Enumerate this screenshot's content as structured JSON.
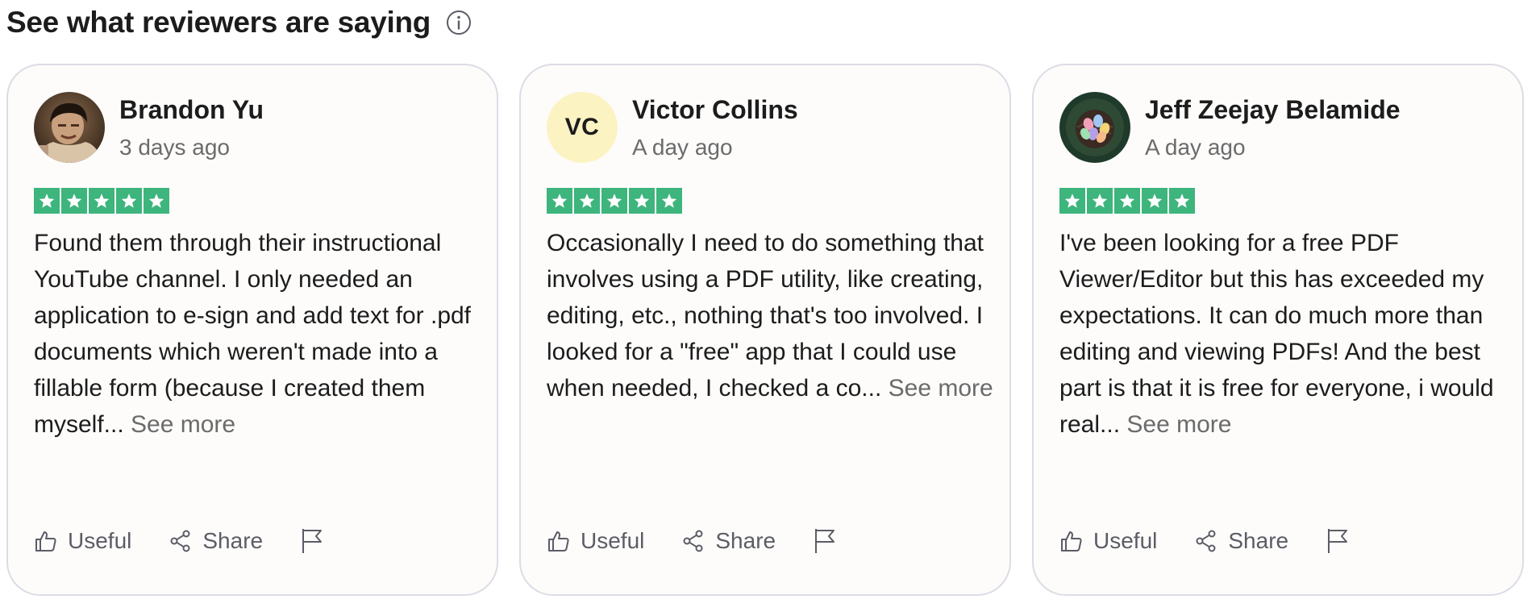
{
  "header": {
    "title": "See what reviewers are saying",
    "info_icon": "info-circle-icon"
  },
  "colors": {
    "star_green": "#3db57d",
    "card_border": "#dcdce6",
    "initials_bg": "#fcf3c3",
    "muted_text": "#6b6b6b"
  },
  "reviews": [
    {
      "name": "Brandon Yu",
      "date": "3 days ago",
      "avatar": "photo-avatar",
      "rating": 5,
      "text": "Found them through their instructional YouTube channel. I only needed an application to e-sign and add text for .pdf documents which weren't made into a fillable form (because I created them myself...",
      "see_more": "See more",
      "useful_label": "Useful",
      "share_label": "Share"
    },
    {
      "name": "Victor Collins",
      "date": "A day ago",
      "avatar_initials": "VC",
      "rating": 5,
      "text": "Occasionally I need to do something that involves using a PDF utility, like creating, editing, etc., nothing that's too involved. I looked for a \"free\" app that I could use when needed, I checked a co...",
      "see_more": "See more",
      "useful_label": "Useful",
      "share_label": "Share"
    },
    {
      "name": "Jeff Zeejay Belamide",
      "date": "A day ago",
      "avatar": "easter-eggs-nest-avatar",
      "rating": 5,
      "text": "I've been looking for a free PDF Viewer/Editor but this has exceeded my expectations. It can do much more than editing and viewing PDFs! And the best part is that it is free for everyone, i would real...",
      "see_more": "See more",
      "useful_label": "Useful",
      "share_label": "Share"
    }
  ]
}
